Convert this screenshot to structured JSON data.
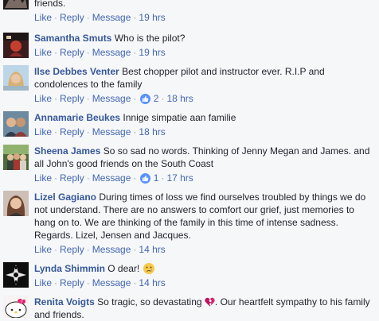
{
  "comments": [
    {
      "author": "",
      "text": "friends.",
      "actions": {
        "like": "Like",
        "reply": "Reply",
        "message": "Message",
        "time": "19 hrs"
      }
    },
    {
      "author": "Samantha Smuts",
      "text": "Who is the pilot?",
      "actions": {
        "like": "Like",
        "reply": "Reply",
        "message": "Message",
        "time": "19 hrs"
      }
    },
    {
      "author": "Ilse Debbes Venter",
      "text": "Best chopper pilot and instructor ever. R.I.P and condolences to the family",
      "actions": {
        "like": "Like",
        "reply": "Reply",
        "message": "Message",
        "reactions": "2",
        "time": "18 hrs"
      }
    },
    {
      "author": "Annamarie Beukes",
      "text": "Innige simpatie aan familie",
      "actions": {
        "like": "Like",
        "reply": "Reply",
        "message": "Message",
        "time": "18 hrs"
      }
    },
    {
      "author": "Sheena James",
      "text": "So so sad no words. Thinking of Jenny Megan and James. and all John's good friends on the South Coast",
      "actions": {
        "like": "Like",
        "reply": "Reply",
        "message": "Message",
        "reactions": "1",
        "time": "17 hrs"
      }
    },
    {
      "author": "Lizel Gagiano",
      "text": "During times of loss we find ourselves troubled by things we do not understand. There are no answers to comfort our grief, just memories to hang on to. We are thinking of the family in this time of intense sadness. Regards. Lizel, Jensen and Jacques.",
      "actions": {
        "like": "Like",
        "reply": "Reply",
        "message": "Message",
        "time": "14 hrs"
      }
    },
    {
      "author": "Lynda Shimmin",
      "text": "O dear!",
      "actions": {
        "like": "Like",
        "reply": "Reply",
        "message": "Message",
        "time": "14 hrs"
      }
    },
    {
      "author": "Renita Voigts",
      "text_before": "So tragic, so devastating",
      "text_after": ". Our heartfelt sympathy to his family and friends."
    }
  ],
  "icons": {
    "like_badge": "thumbs-up-icon",
    "sad_emoji": "sad-face-icon",
    "broken_heart": "broken-heart-icon"
  },
  "colors": {
    "author_link": "#365899",
    "action_link": "#4267b2",
    "meta_gray": "#90949c",
    "like_blue": "#5890ff",
    "background": "#f6f7f9"
  }
}
